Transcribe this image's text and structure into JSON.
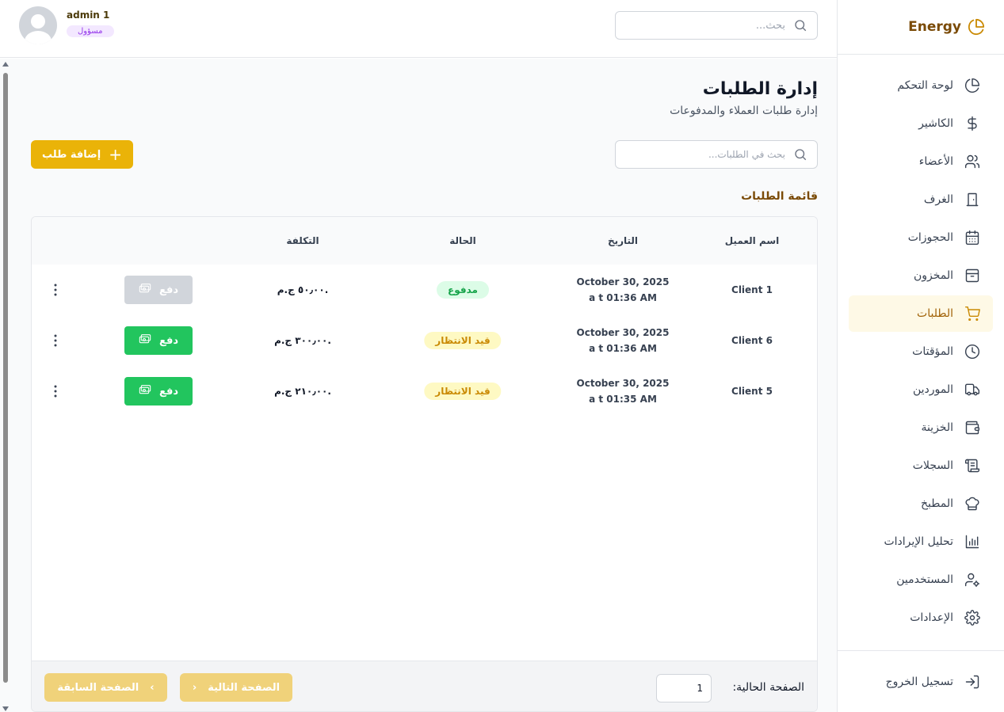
{
  "brand": {
    "name": "Energy"
  },
  "header": {
    "search_placeholder": "بحث...",
    "user": {
      "name": "admin 1",
      "role": "مسؤول"
    }
  },
  "sidebar": {
    "items": [
      {
        "label": "لوحة التحكم",
        "icon": "pie-chart-icon"
      },
      {
        "label": "الكاشير",
        "icon": "dollar-icon"
      },
      {
        "label": "الأعضاء",
        "icon": "users-icon"
      },
      {
        "label": "الغرف",
        "icon": "door-icon"
      },
      {
        "label": "الحجوزات",
        "icon": "calendar-icon"
      },
      {
        "label": "المخزون",
        "icon": "box-icon"
      },
      {
        "label": "الطلبات",
        "icon": "cart-icon",
        "active": true
      },
      {
        "label": "المؤقتات",
        "icon": "clock-icon"
      },
      {
        "label": "الموردين",
        "icon": "truck-icon"
      },
      {
        "label": "الخزينة",
        "icon": "wallet-icon"
      },
      {
        "label": "السجلات",
        "icon": "scroll-icon"
      },
      {
        "label": "المطبخ",
        "icon": "chef-hat-icon"
      },
      {
        "label": "تحليل الإيرادات",
        "icon": "bar-chart-icon"
      },
      {
        "label": "المستخدمين",
        "icon": "user-cog-icon"
      },
      {
        "label": "الإعدادات",
        "icon": "gear-icon"
      }
    ],
    "logout": {
      "label": "تسجيل الخروج",
      "icon": "logout-icon"
    }
  },
  "main": {
    "title": "إدارة الطلبات",
    "subtitle": "إدارة طلبات العملاء والمدفوعات",
    "add_button": "إضافة طلب",
    "search_placeholder": "بحث في الطلبات...",
    "list_title": "قائمة الطلبات",
    "table": {
      "headers": {
        "client": "اسم العميل",
        "date": "التاريخ",
        "status": "الحالة",
        "cost": "التكلفة"
      },
      "rows": [
        {
          "client": "Client 1",
          "date": "October 30, 2025 a t 01:36 AM",
          "status": "مدفوع",
          "status_type": "paid",
          "cost": "٥٠٫٠٠ ج.م.",
          "pay": "دفع",
          "pay_enabled": false
        },
        {
          "client": "Client 6",
          "date": "October 30, 2025 a t 01:36 AM",
          "status": "قيد الانتظار",
          "status_type": "pending",
          "cost": "٣٠٠٫٠٠ ج.م.",
          "pay": "دفع",
          "pay_enabled": true
        },
        {
          "client": "Client 5",
          "date": "October 30, 2025 a t 01:35 AM",
          "status": "قيد الانتظار",
          "status_type": "pending",
          "cost": "٢١٠٫٠٠ ج.م.",
          "pay": "دفع",
          "pay_enabled": true
        }
      ]
    },
    "pagination": {
      "prev": "الصفحة السابقة",
      "next": "الصفحة التالية",
      "current_label": "الصفحة الحالية:",
      "current_page": "1"
    }
  },
  "colors": {
    "accent": "#eab308",
    "brand": "#7a4a06",
    "paid": "#16a34a",
    "pending": "#ca8a04",
    "pay": "#22c55e"
  }
}
